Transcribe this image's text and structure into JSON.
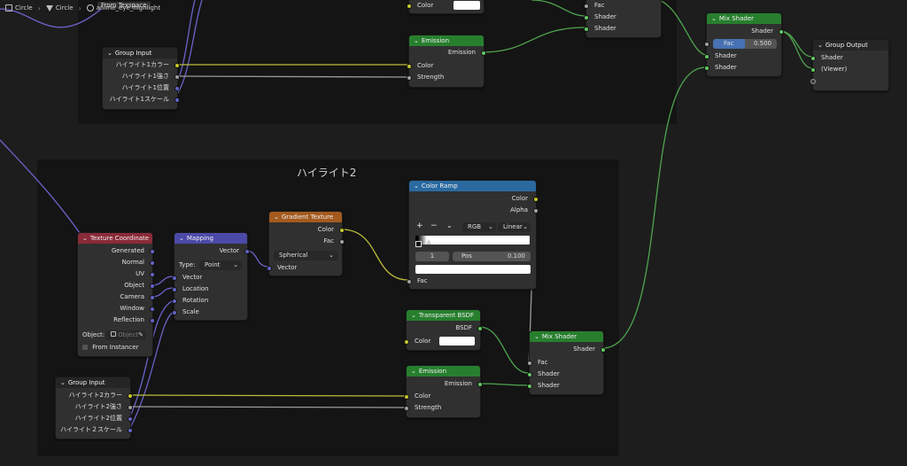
{
  "breadcrumb": {
    "items": [
      {
        "label": "Circle",
        "icon": "object-icon"
      },
      {
        "label": "Circle",
        "icon": "mesh-icon"
      },
      {
        "label": "anime_eye_highlight",
        "icon": "material-icon"
      }
    ],
    "from_texspace_label": "From Texspace"
  },
  "frame_bottom": {
    "label": "ハイライト2"
  },
  "colors": {
    "shader_header": "#277f2e",
    "input_header": "#8a2a38",
    "vector_header": "#4c4aa8",
    "texture_header": "#a45a1e",
    "converter_header": "#2a6aa0",
    "wire_shader": "#4fa54f",
    "wire_color": "#bcbc3a",
    "wire_float": "#9b9b9b",
    "wire_vector": "#6a64c8"
  },
  "top": {
    "color_field": {
      "label": "Color"
    },
    "mix_partial": {
      "fac": "Fac",
      "shader1": "Shader",
      "shader2": "Shader"
    },
    "group_input": {
      "title": "Group Input",
      "outputs": [
        "ハイライト1カラー",
        "ハイライト1強さ",
        "ハイライト1位置",
        "ハイライト1スケール"
      ]
    },
    "emission": {
      "title": "Emission",
      "output": "Emission",
      "inputs": [
        "Color",
        "Strength"
      ]
    },
    "mix_shader": {
      "title": "Mix Shader",
      "output": "Shader",
      "fac_label": "Fac",
      "fac_value": "0.500",
      "inputs": [
        "Shader",
        "Shader"
      ]
    },
    "group_output": {
      "title": "Group Output",
      "inputs": [
        "Shader",
        "(Viewer)"
      ]
    }
  },
  "bottom": {
    "texture_coordinate": {
      "title": "Texture Coordinate",
      "outputs": [
        "Generated",
        "Normal",
        "UV",
        "Object",
        "Camera",
        "Window",
        "Reflection"
      ],
      "object_label": "Object:",
      "object_placeholder": "Object",
      "from_instancer": "From Instancer"
    },
    "mapping": {
      "title": "Mapping",
      "output": "Vector",
      "type_label": "Type:",
      "type_value": "Point",
      "inputs": [
        "Vector",
        "Location",
        "Rotation",
        "Scale"
      ]
    },
    "gradient_texture": {
      "title": "Gradient Texture",
      "outputs": [
        "Color",
        "Fac"
      ],
      "mode": "Spherical",
      "input": "Vector"
    },
    "color_ramp": {
      "title": "Color Ramp",
      "outputs": [
        "Color",
        "Alpha"
      ],
      "plus": "+",
      "minus": "−",
      "mode": "RGB",
      "interp": "Linear",
      "stop_index": "1",
      "pos_label": "Pos",
      "pos_value": "0.100",
      "input": "Fac"
    },
    "transparent_bsdf": {
      "title": "Transparent BSDF",
      "output": "BSDF",
      "input": "Color"
    },
    "mix_shader": {
      "title": "Mix Shader",
      "output": "Shader",
      "inputs": [
        "Fac",
        "Shader",
        "Shader"
      ]
    },
    "emission": {
      "title": "Emission",
      "output": "Emission",
      "inputs": [
        "Color",
        "Strength"
      ]
    },
    "group_input": {
      "title": "Group Input",
      "outputs": [
        "ハイライト2カラー",
        "ハイライト2強さ",
        "ハイライト2位置",
        "ハイライト２スケール"
      ]
    }
  }
}
